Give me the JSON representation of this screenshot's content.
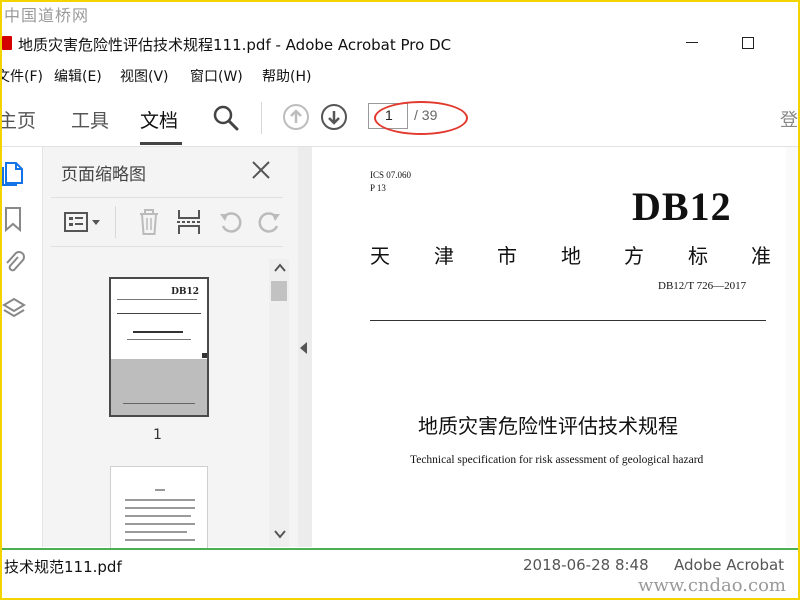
{
  "watermark": {
    "top": "中国道桥网",
    "bottom": "www.cndao.com"
  },
  "window": {
    "title": "地质灾害危险性评估技术规程111.pdf - Adobe Acrobat Pro DC"
  },
  "menu": [
    "文件(F)",
    "编辑(E)",
    "视图(V)",
    "窗口(W)",
    "帮助(H)"
  ],
  "toolbar": {
    "tabs": [
      "主页",
      "工具",
      "文档"
    ],
    "active_tab": "文档",
    "current_page": "1",
    "total_pages": "/ 39",
    "right_edge_text": "登"
  },
  "panel": {
    "title": "页面缩略图",
    "thumbnails": [
      {
        "label": "1",
        "selected": true
      },
      {
        "label": "",
        "selected": false
      }
    ],
    "thumb_db": "DB12"
  },
  "document": {
    "ics": "ICS 07.060",
    "class_code": "P 13",
    "db_code": "DB12",
    "standard_chars": [
      "天",
      "津",
      "市",
      "地",
      "方",
      "标",
      "准"
    ],
    "std_number": "DB12/T 726—2017",
    "title_cn": "地质灾害危险性评估技术规程",
    "title_en": "Technical specification for risk assessment of geological hazard"
  },
  "status": {
    "filename": "技术规范111.pdf",
    "date": "2018-06-28 8:48",
    "app": "Adobe Acrobat"
  },
  "colors": {
    "frame": "#f1d400",
    "annotation": "#e23a2e",
    "status_line": "#4caf50",
    "accent_icon": "#1473e6"
  },
  "icons": {
    "search": "search-icon",
    "up": "arrow-up-circle-icon",
    "down": "arrow-down-circle-icon",
    "close": "close-icon"
  }
}
